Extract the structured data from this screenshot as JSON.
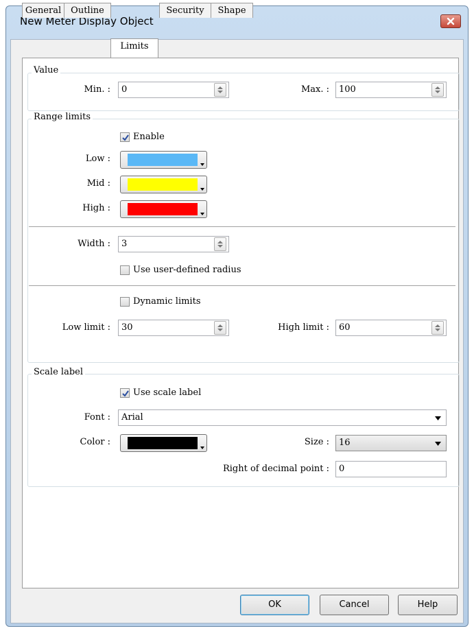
{
  "window": {
    "title": "New Meter Display Object"
  },
  "tabs": [
    "General",
    "Outline",
    "Limits",
    "Security",
    "Shape"
  ],
  "value_group": {
    "legend": "Value",
    "min_label": "Min. :",
    "min_value": "0",
    "max_label": "Max. :",
    "max_value": "100"
  },
  "range_group": {
    "legend": "Range limits",
    "enable_label": "Enable",
    "enable_checked": true,
    "low_label": "Low :",
    "low_color": "#5ab8f6",
    "mid_label": "Mid :",
    "mid_color": "#ffff00",
    "high_label": "High :",
    "high_color": "#ff0000",
    "width_label": "Width :",
    "width_value": "3",
    "user_radius_label": "Use user-defined radius",
    "user_radius_checked": false,
    "dynamic_label": "Dynamic limits",
    "dynamic_checked": false,
    "low_limit_label": "Low limit :",
    "low_limit_value": "30",
    "high_limit_label": "High limit :",
    "high_limit_value": "60"
  },
  "scale_group": {
    "legend": "Scale label",
    "use_scale_label": "Use scale label",
    "use_scale_checked": true,
    "font_label": "Font :",
    "font_value": "Arial",
    "color_label": "Color :",
    "color_value": "#000000",
    "size_label": "Size :",
    "size_value": "16",
    "decimal_label": "Right of decimal point :",
    "decimal_value": "0"
  },
  "buttons": {
    "ok": "OK",
    "cancel": "Cancel",
    "help": "Help"
  }
}
